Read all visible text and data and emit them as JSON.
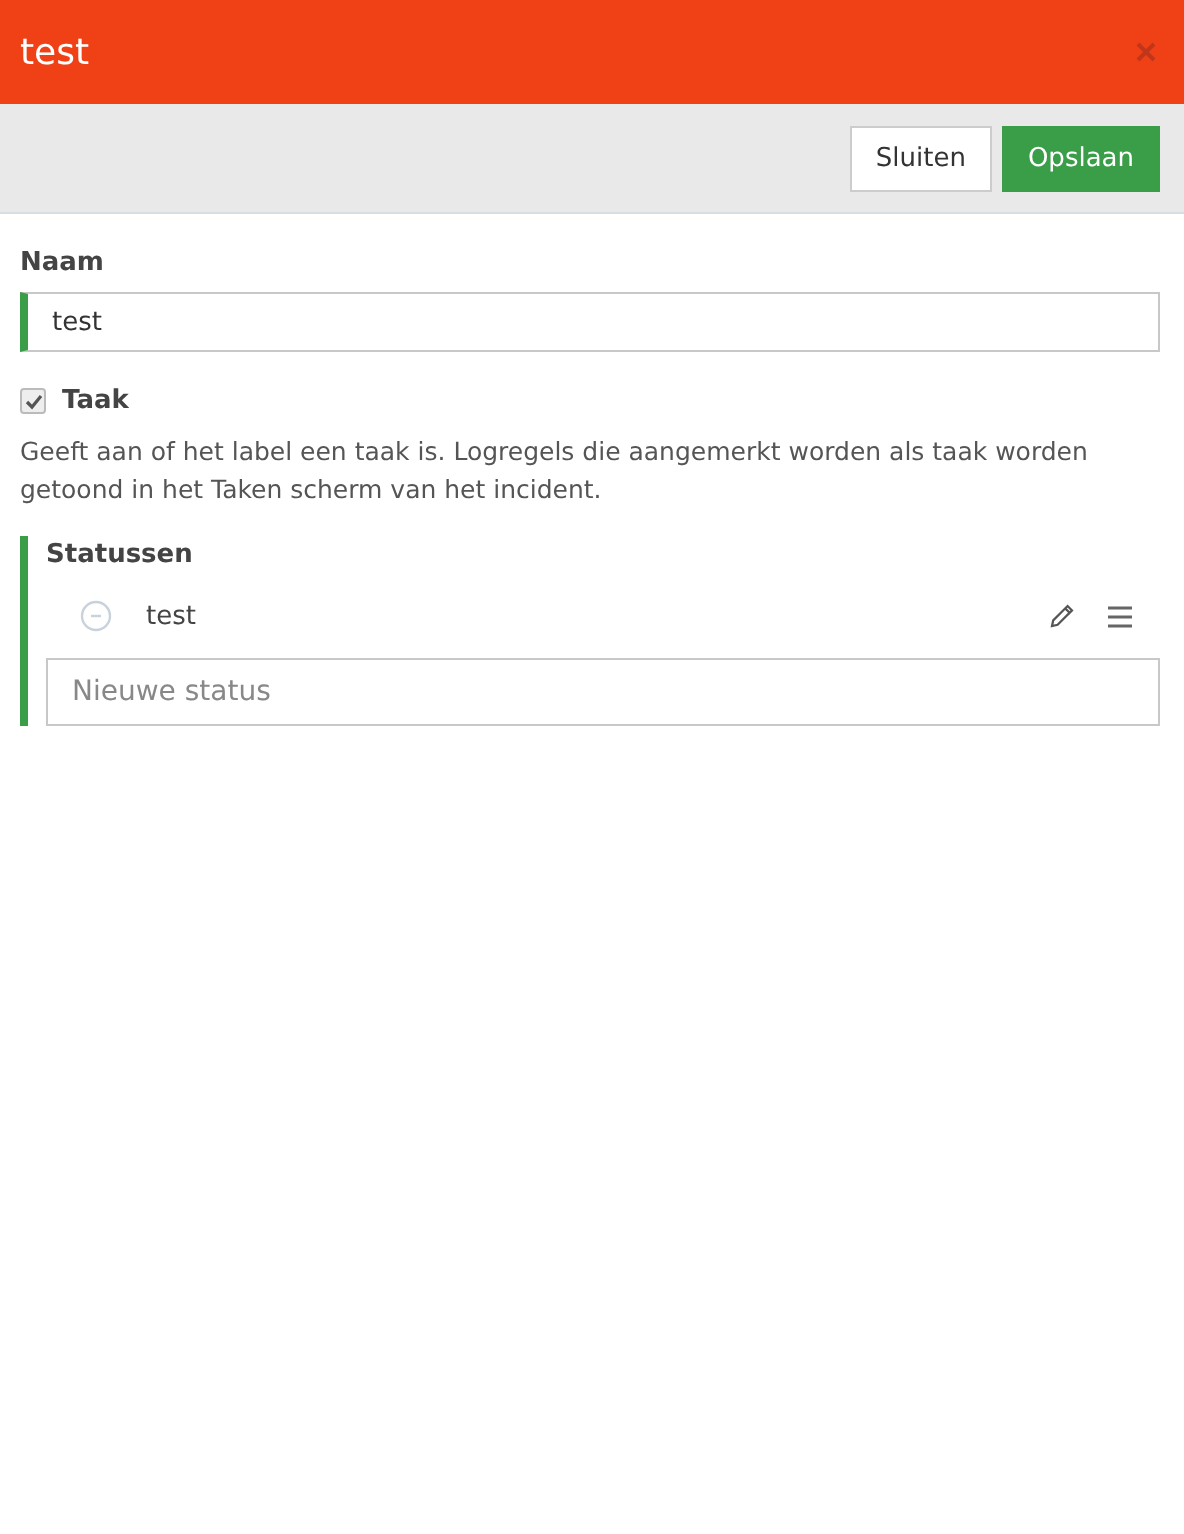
{
  "window": {
    "title": "test"
  },
  "buttons": [
    {
      "label": "Sluiten",
      "kind": "default"
    },
    {
      "label": "Opslaan",
      "kind": "primary"
    }
  ],
  "name_field": {
    "label": "Naam",
    "value": "test"
  },
  "task": {
    "label": "Taak",
    "checked": true,
    "description": "Geeft aan of het label een taak is. Logregels die aangemerkt worden als taak worden getoond in het Taken scherm van het incident."
  },
  "statuses": {
    "title": "Statussen",
    "items": [
      {
        "name": "test"
      }
    ],
    "new_placeholder": "Nieuwe status"
  }
}
